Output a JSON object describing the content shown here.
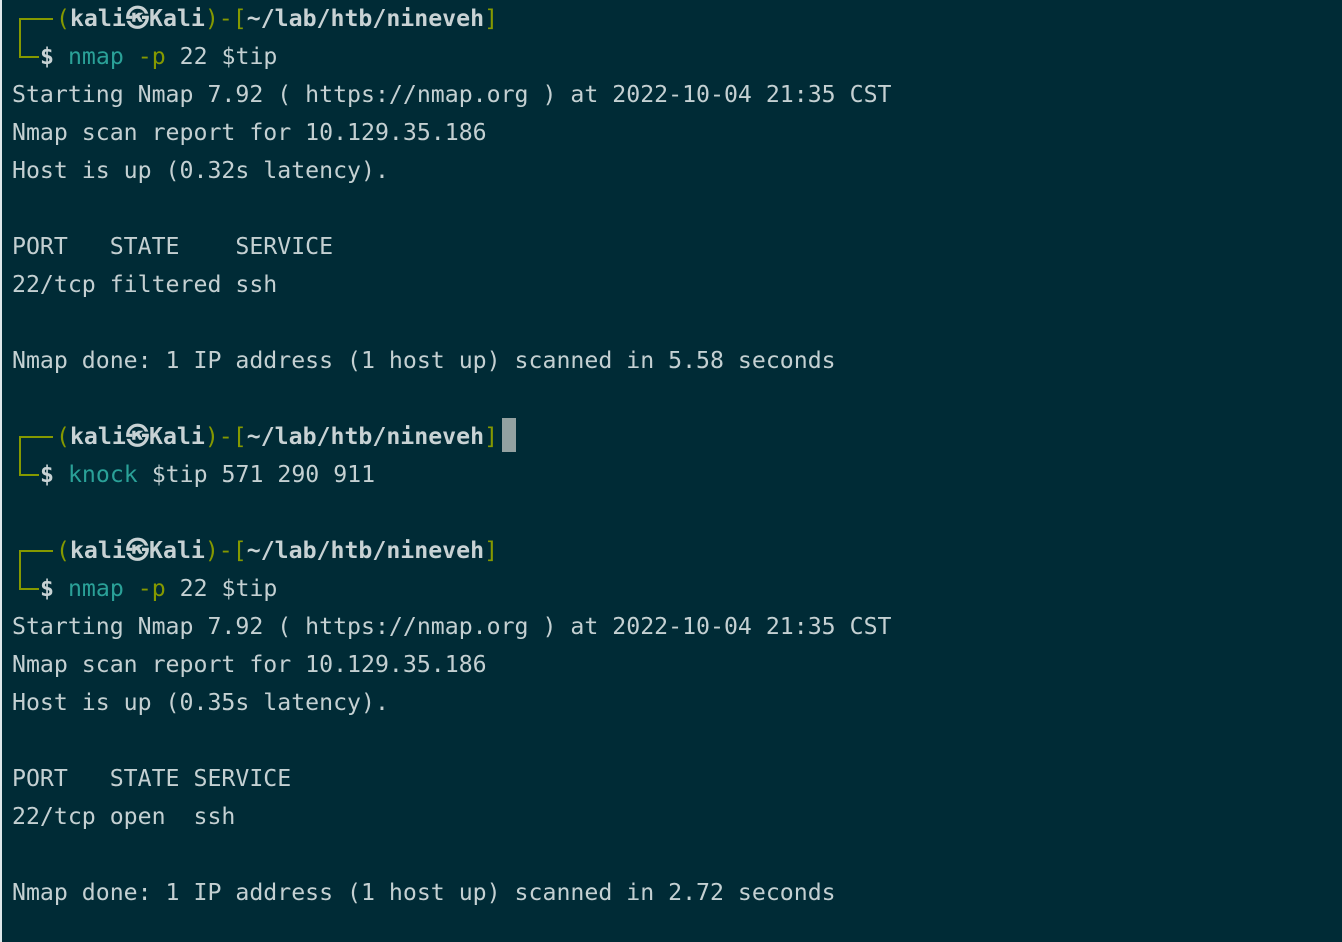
{
  "prompt": {
    "user": "kali",
    "separator": "㉿",
    "host": "Kali",
    "path": "~/lab/htb/nineveh",
    "symbol": "$"
  },
  "blocks": [
    {
      "command": {
        "name": "nmap",
        "option": "-p",
        "args": "22 $tip"
      },
      "output": [
        "Starting Nmap 7.92 ( https://nmap.org ) at 2022-10-04 21:35 CST",
        "Nmap scan report for 10.129.35.186",
        "Host is up (0.32s latency).",
        "",
        "PORT   STATE    SERVICE",
        "22/tcp filtered ssh",
        "",
        "Nmap done: 1 IP address (1 host up) scanned in 5.58 seconds",
        ""
      ]
    },
    {
      "command": {
        "name": "knock",
        "option": "",
        "args": "$tip 571 290 911"
      },
      "output": [
        ""
      ]
    },
    {
      "command": {
        "name": "nmap",
        "option": "-p",
        "args": "22 $tip"
      },
      "output": [
        "Starting Nmap 7.92 ( https://nmap.org ) at 2022-10-04 21:35 CST",
        "Nmap scan report for 10.129.35.186",
        "Host is up (0.35s latency).",
        "",
        "PORT   STATE SERVICE",
        "22/tcp open  ssh",
        "",
        "Nmap done: 1 IP address (1 host up) scanned in 2.72 seconds"
      ]
    }
  ],
  "colors": {
    "background": "#002b36",
    "prompt_frame": "#859900",
    "command": "#2aa198",
    "text": "#c4d0d2",
    "cursor": "#93a1a1"
  }
}
